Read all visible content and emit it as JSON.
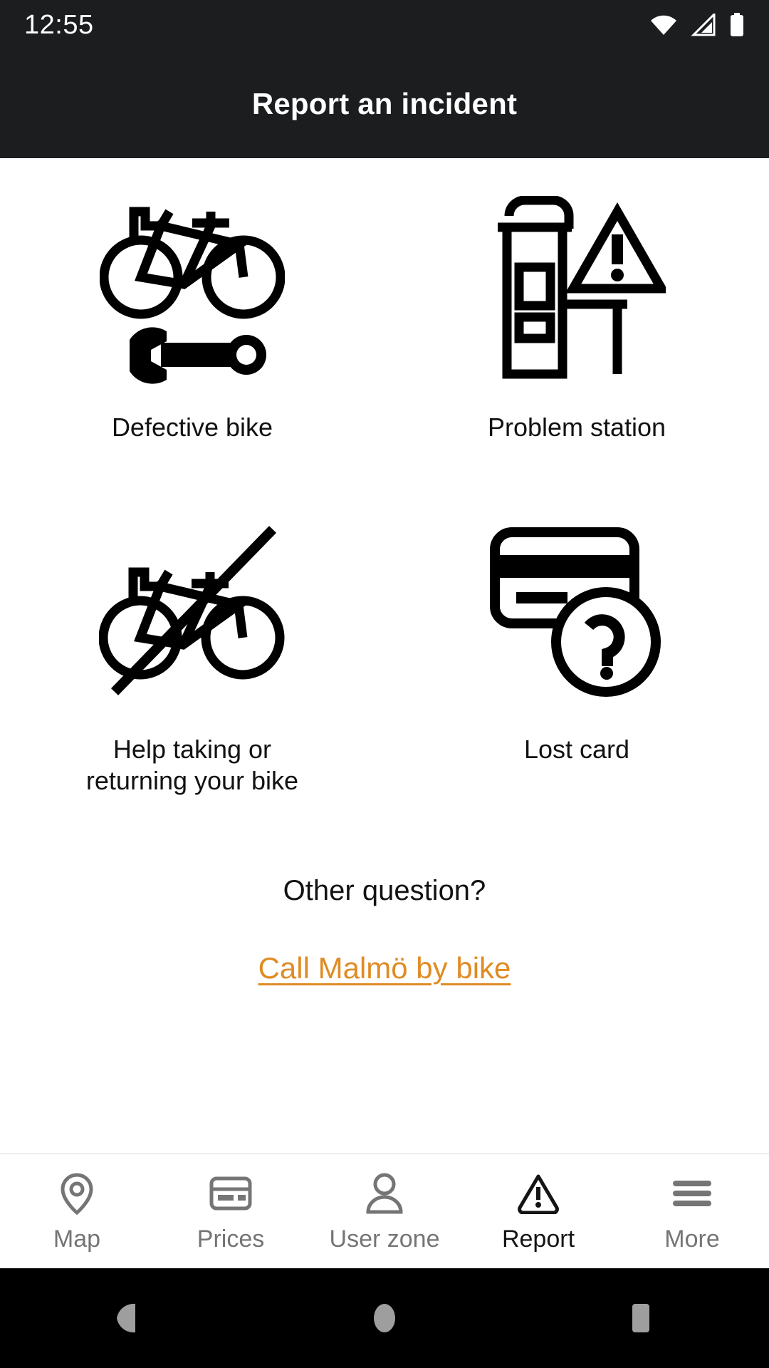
{
  "status_bar": {
    "time": "12:55",
    "icons": [
      "wifi-icon",
      "cellular-signal-icon",
      "battery-icon"
    ]
  },
  "app_bar": {
    "title": "Report an incident"
  },
  "main": {
    "options": [
      {
        "label": "Defective bike",
        "icon": "bike-wrench-icon"
      },
      {
        "label": "Problem station",
        "icon": "station-warning-icon"
      },
      {
        "label": "Help taking or\nreturning your bike",
        "icon": "bike-crossed-out-icon"
      },
      {
        "label": "Lost card",
        "icon": "card-question-icon"
      }
    ],
    "other_question": "Other question?",
    "call_link": "Call Malmö by bike"
  },
  "bottom_nav": {
    "items": [
      {
        "label": "Map",
        "icon": "map-pin-icon",
        "active": false
      },
      {
        "label": "Prices",
        "icon": "credit-card-icon",
        "active": false
      },
      {
        "label": "User zone",
        "icon": "person-icon",
        "active": false
      },
      {
        "label": "Report",
        "icon": "warning-triangle-icon",
        "active": true
      },
      {
        "label": "More",
        "icon": "hamburger-menu-icon",
        "active": false
      }
    ]
  },
  "system_nav": {
    "buttons": [
      "back-icon",
      "home-icon",
      "recents-icon"
    ]
  },
  "colors": {
    "header_background": "#1b1d1f",
    "page_background": "#ffffff",
    "link_orange": "#e08b24",
    "text_primary": "#121212",
    "nav_inactive": "#757575",
    "nav_active": "#141414"
  }
}
